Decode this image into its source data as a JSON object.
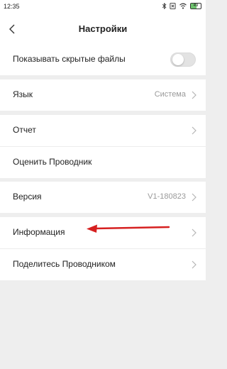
{
  "status_bar": {
    "time": "12:35",
    "icons": [
      "bluetooth-icon",
      "sim-icon",
      "wifi-icon",
      "battery-icon"
    ],
    "battery_level": "49"
  },
  "header": {
    "title": "Настройки",
    "back_icon": "chevron-left-icon"
  },
  "settings": {
    "show_hidden": {
      "label": "Показывать скрытые файлы",
      "enabled": false
    },
    "language": {
      "label": "Язык",
      "value": "Система"
    },
    "report": {
      "label": "Отчет"
    },
    "rate": {
      "label": "Оценить Проводник"
    },
    "version": {
      "label": "Версия",
      "value": "V1-180823"
    },
    "info": {
      "label": "Информация"
    },
    "share": {
      "label": "Поделитесь Проводником"
    }
  },
  "annotation": {
    "color": "#d62020",
    "icon": "red-arrow-left"
  },
  "colors": {
    "background": "#eeeeee",
    "row": "#ffffff",
    "secondary_text": "#9a9a9a"
  }
}
